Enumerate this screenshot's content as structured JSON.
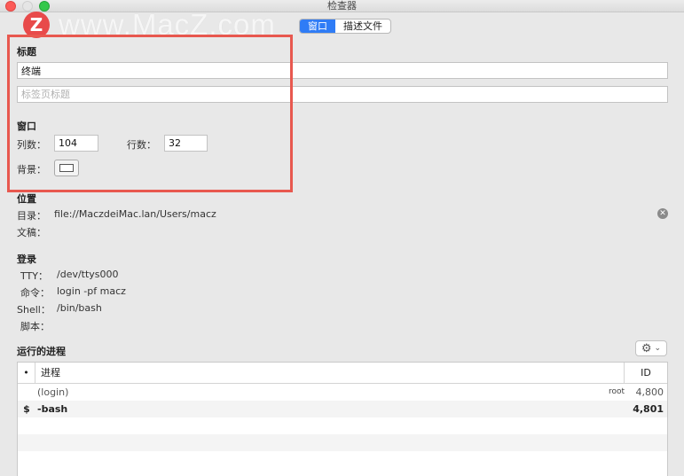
{
  "window": {
    "title": "检查器"
  },
  "watermark": {
    "logo": "Z",
    "text": "www.MacZ.com"
  },
  "tabs": [
    {
      "label": "窗口",
      "active": true
    },
    {
      "label": "描述文件",
      "active": false
    }
  ],
  "title_section": {
    "heading": "标题",
    "title_value": "终端",
    "tab_title_placeholder": "标签页标题"
  },
  "window_section": {
    "heading": "窗口",
    "columns_label": "列数：",
    "columns_value": "104",
    "rows_label": "行数：",
    "rows_value": "32",
    "background_label": "背景："
  },
  "location_section": {
    "heading": "位置",
    "directory_label": "目录：",
    "directory_value": "file://MaczdeiMac.lan/Users/macz",
    "document_label": "文稿："
  },
  "login_section": {
    "heading": "登录",
    "tty_label": "TTY：",
    "tty_value": "/dev/ttys000",
    "command_label": "命令：",
    "command_value": "login -pf macz",
    "shell_label": "Shell：",
    "shell_value": "/bin/bash",
    "script_label": "脚本："
  },
  "processes_section": {
    "heading": "运行的进程",
    "columns": {
      "dot": "•",
      "process": "进程",
      "id": "ID"
    },
    "rows": [
      {
        "mark": "",
        "name": "(login)",
        "user": "root",
        "id": "4,800",
        "bold": false
      },
      {
        "mark": "$",
        "name": "-bash",
        "user": "",
        "id": "4,801",
        "bold": true
      }
    ]
  },
  "icons": {
    "gear": "⚙",
    "chevron": "⌄",
    "clear": "✕"
  },
  "colors": {
    "accent": "#2f7cf6",
    "highlight": "#e8584f",
    "close": "#fc5b57",
    "zoom": "#34c84a"
  }
}
